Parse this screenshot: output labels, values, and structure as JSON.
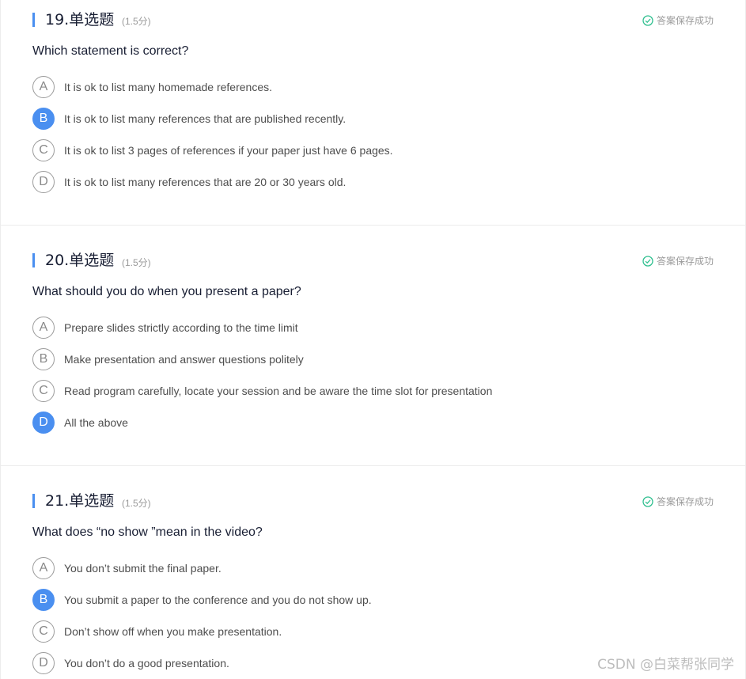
{
  "saved_label": "答案保存成功",
  "questions": [
    {
      "number_title": "19.单选题",
      "score": "(1.5分)",
      "text": "Which statement is correct?",
      "options": [
        {
          "letter": "A",
          "text": "It is ok to list many homemade references.",
          "selected": false
        },
        {
          "letter": "B",
          "text": "It is ok to list many references that are published recently.",
          "selected": true
        },
        {
          "letter": "C",
          "text": "It is ok to list 3 pages of references if your paper just have 6 pages.",
          "selected": false
        },
        {
          "letter": "D",
          "text": "It is ok to list many references that are 20 or 30 years old.",
          "selected": false
        }
      ]
    },
    {
      "number_title": "20.单选题",
      "score": "(1.5分)",
      "text": "What should you do when you present a paper?",
      "options": [
        {
          "letter": "A",
          "text": "Prepare slides strictly according to the time limit",
          "selected": false
        },
        {
          "letter": "B",
          "text": "Make presentation and answer questions politely",
          "selected": false
        },
        {
          "letter": "C",
          "text": "Read program carefully, locate your session and be aware the time slot for presentation",
          "selected": false
        },
        {
          "letter": "D",
          "text": "All the above",
          "selected": true
        }
      ]
    },
    {
      "number_title": "21.单选题",
      "score": "(1.5分)",
      "text": "What does “no show ”mean in the video?",
      "options": [
        {
          "letter": "A",
          "text": "You don’t submit the final paper.",
          "selected": false
        },
        {
          "letter": "B",
          "text": "You submit a paper to the conference and you do not show up.",
          "selected": true
        },
        {
          "letter": "C",
          "text": "Don’t show off when you make presentation.",
          "selected": false
        },
        {
          "letter": "D",
          "text": "You don’t do a good presentation.",
          "selected": false
        }
      ]
    }
  ],
  "watermark": "CSDN @白菜帮张同学",
  "colors": {
    "accent": "#4a8ff0",
    "saved_check": "#2fbf8f"
  }
}
